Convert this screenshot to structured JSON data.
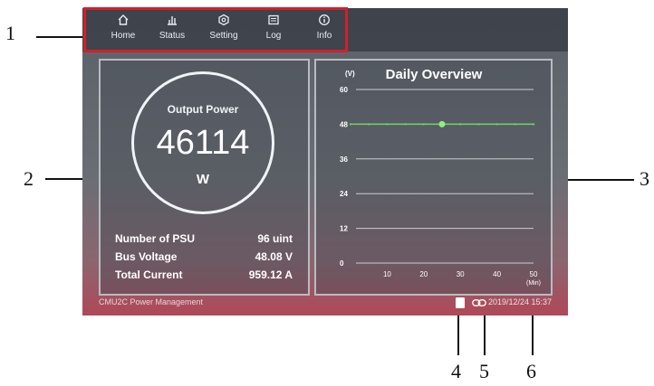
{
  "annotations": [
    "1",
    "2",
    "3",
    "4",
    "5",
    "6"
  ],
  "nav": {
    "items": [
      {
        "label": "Home",
        "icon": "home-icon"
      },
      {
        "label": "Status",
        "icon": "bar-chart-icon"
      },
      {
        "label": "Setting",
        "icon": "gear-icon"
      },
      {
        "label": "Log",
        "icon": "log-icon"
      },
      {
        "label": "Info",
        "icon": "info-icon"
      }
    ],
    "active": "Home"
  },
  "output": {
    "title": "Output Power",
    "value": "46114",
    "unit": "W"
  },
  "stats": [
    {
      "label": "Number of PSU",
      "value": "96 uint"
    },
    {
      "label": "Bus Voltage",
      "value": "48.08  V"
    },
    {
      "label": "Total Current",
      "value": "959.12  A"
    }
  ],
  "chart_data": {
    "type": "line",
    "title": "Daily Overview",
    "ylabel": "(V)",
    "xlabel": "(Min)",
    "yticks": [
      0,
      12,
      24,
      36,
      48,
      60
    ],
    "xticks": [
      10,
      20,
      30,
      40,
      50
    ],
    "ylim": [
      0,
      60
    ],
    "xlim": [
      0,
      50
    ],
    "series": [
      {
        "x": [
          0,
          5,
          10,
          15,
          20,
          25,
          30,
          35,
          40,
          45,
          50
        ],
        "values": [
          48,
          48,
          48,
          48,
          48,
          48,
          48,
          48,
          48,
          48,
          48
        ]
      }
    ],
    "marker_x": 25,
    "line_color": "#6fd06a",
    "grid": true
  },
  "footer": {
    "app": "CMU2C Power Management",
    "datetime": "2019/12/24 15:37"
  },
  "colors": {
    "accent": "#d2202a"
  }
}
